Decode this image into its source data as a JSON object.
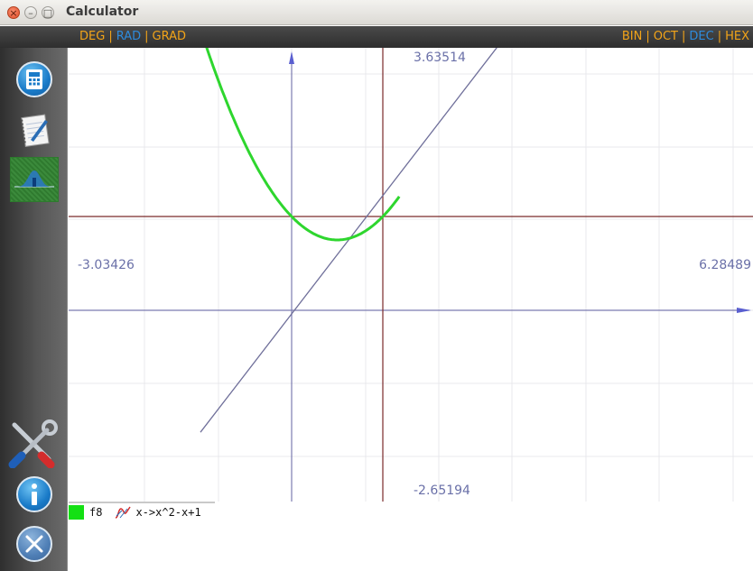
{
  "window": {
    "title": "Calculator",
    "controls": {
      "close": "×",
      "minimize": "–",
      "maximize": "□"
    }
  },
  "modes": {
    "angle": [
      {
        "label": "DEG",
        "active": false
      },
      {
        "label": "RAD",
        "active": true
      },
      {
        "label": "GRAD",
        "active": false
      }
    ],
    "base": [
      {
        "label": "BIN",
        "active": false
      },
      {
        "label": "OCT",
        "active": false
      },
      {
        "label": "DEC",
        "active": true
      },
      {
        "label": "HEX",
        "active": false
      }
    ],
    "separator": "|"
  },
  "sidebar": {
    "items": [
      {
        "name": "calculator-icon",
        "active": false
      },
      {
        "name": "notepad-icon",
        "active": false
      },
      {
        "name": "graph-icon",
        "active": true
      },
      {
        "name": "tools-icon",
        "active": false
      },
      {
        "name": "info-icon",
        "active": false
      },
      {
        "name": "exit-icon",
        "active": false
      }
    ]
  },
  "graph": {
    "bounds": {
      "ymax": "3.63514",
      "ymin": "-2.65194",
      "xmin": "-3.03426",
      "xmax": "6.28489"
    },
    "colors": {
      "curve": "#2ed62e",
      "tangent": "#6f6f9a",
      "axis": "#7b7bb0",
      "reference": "#7a2a2a"
    }
  },
  "chart_data": {
    "type": "line",
    "title": "",
    "xlabel": "",
    "ylabel": "",
    "xlim": [
      -1.2,
      1.4
    ],
    "ylim": [
      -0.5,
      3.5
    ],
    "series": [
      {
        "name": "f8",
        "expr": "x->x^2-x+1",
        "x": [
          -1.2,
          -1.0,
          -0.8,
          -0.6,
          -0.4,
          -0.2,
          0.0,
          0.2,
          0.4,
          0.6,
          0.8
        ],
        "y": [
          3.64,
          3.0,
          2.44,
          1.96,
          1.56,
          1.24,
          1.0,
          0.84,
          0.76,
          0.76,
          0.84
        ]
      }
    ]
  },
  "legend": {
    "entries": [
      {
        "name": "f8",
        "expression": "x->x^2-x+1",
        "color": "#14e014"
      }
    ]
  }
}
